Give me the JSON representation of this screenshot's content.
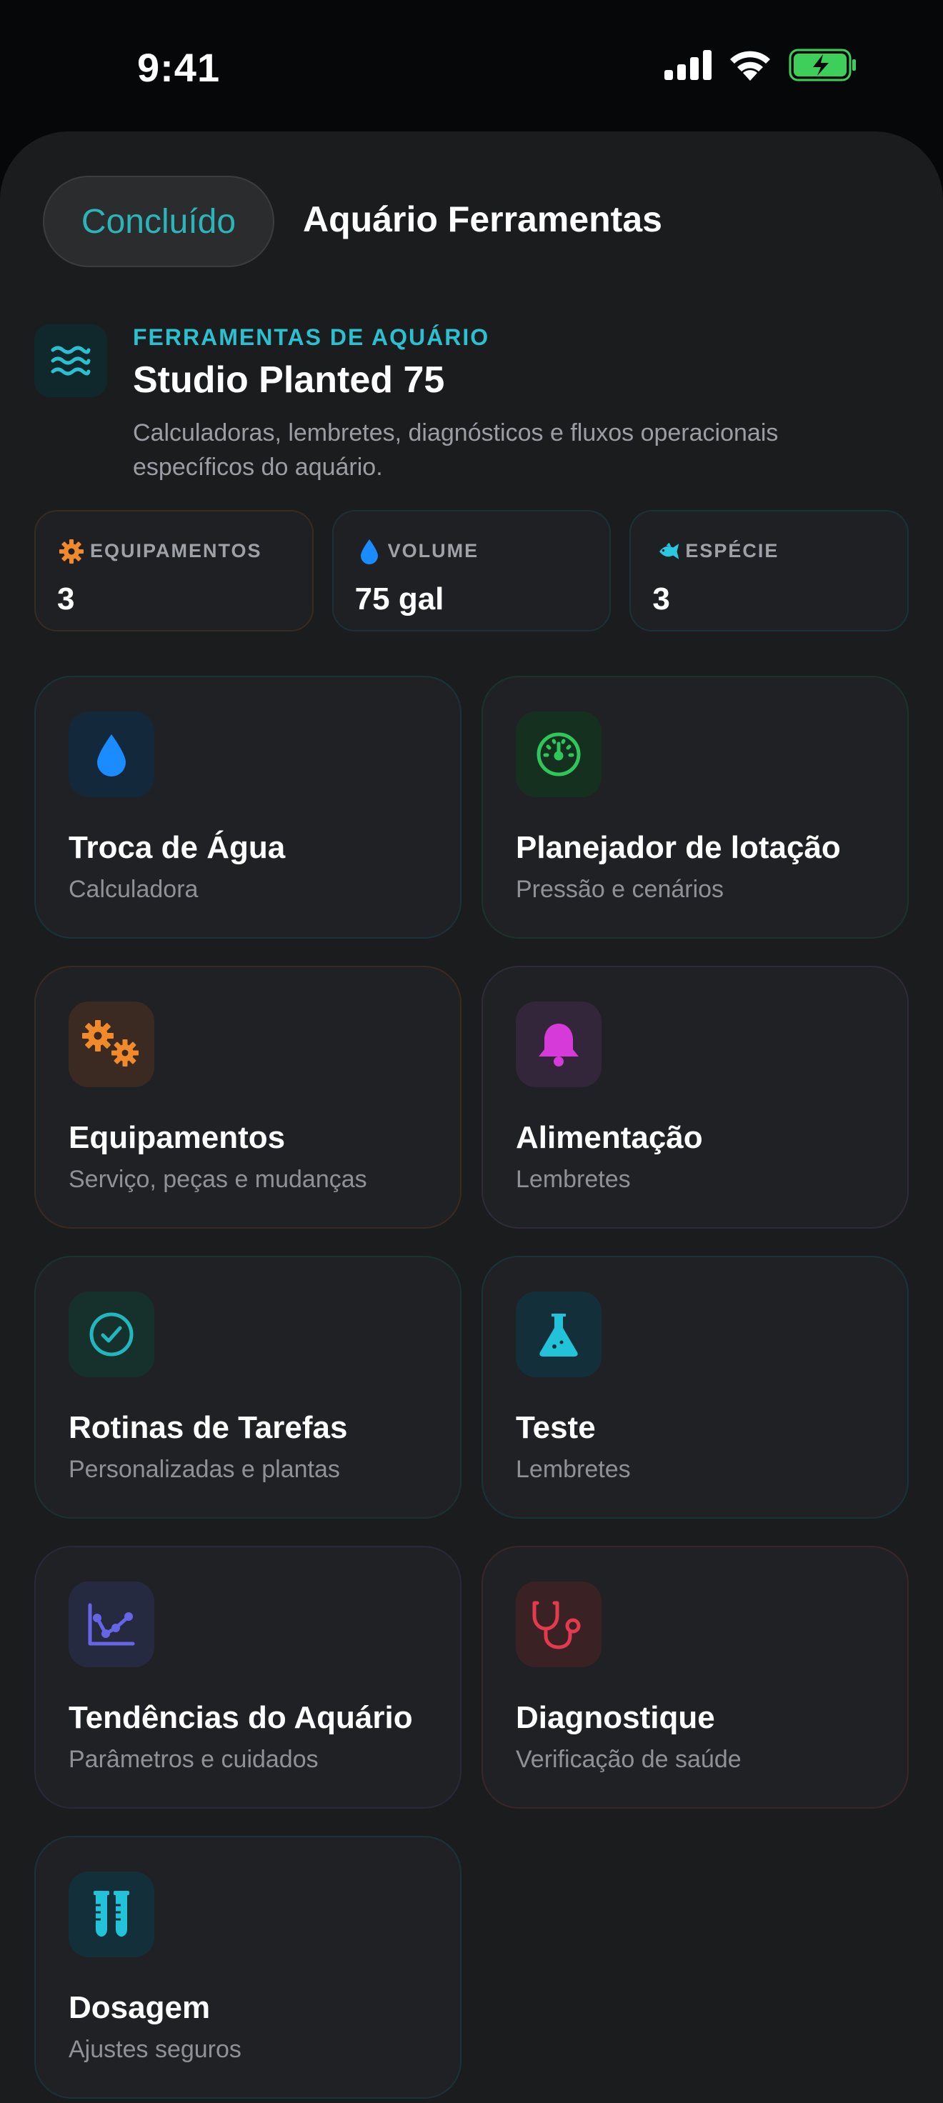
{
  "status_bar": {
    "time": "9:41"
  },
  "header": {
    "done_label": "Concluído",
    "title": "Aquário Ferramentas"
  },
  "hero": {
    "icon": "waves-icon",
    "kicker": "FERRAMENTAS DE AQUÁRIO",
    "title": "Studio Planted 75",
    "description": "Calculadoras, lembretes, diagnósticos e fluxos operacionais específicos do aquário."
  },
  "stats": [
    {
      "icon": "gear-icon",
      "label": "EQUIPAMENTOS",
      "value": "3",
      "color": "#f08a2a"
    },
    {
      "icon": "drop-icon",
      "label": "VOLUME",
      "value": "75 gal",
      "color": "#1a8cff"
    },
    {
      "icon": "fish-icon",
      "label": "ESPÉCIE",
      "value": "3",
      "color": "#2bc7e0"
    }
  ],
  "tools": [
    {
      "name": "water-change",
      "icon": "drop-icon",
      "title": "Troca de Água",
      "subtitle": "Calculadora",
      "accent": "#1a8cff"
    },
    {
      "name": "stocking-planner",
      "icon": "gauge-icon",
      "title": "Planejador de lotação",
      "subtitle": "Pressão e cenários",
      "accent": "#2fc75a"
    },
    {
      "name": "equipment",
      "icon": "gears-icon",
      "title": "Equipamentos",
      "subtitle": "Serviço, peças e mudanças",
      "accent": "#f08a2a"
    },
    {
      "name": "feeding",
      "icon": "bell-icon",
      "title": "Alimentação",
      "subtitle": "Lembretes",
      "accent": "#d63ad8"
    },
    {
      "name": "task-routines",
      "icon": "check-circle-icon",
      "title": "Rotinas de Tarefas",
      "subtitle": "Personalizadas e plantas",
      "accent": "#22b7bf"
    },
    {
      "name": "testing",
      "icon": "flask-icon",
      "title": "Teste",
      "subtitle": "Lembretes",
      "accent": "#22c3d8"
    },
    {
      "name": "aquarium-trends",
      "icon": "chart-icon",
      "title": "Tendências do Aquário",
      "subtitle": "Parâmetros e cuidados",
      "accent": "#6466e6"
    },
    {
      "name": "diagnose",
      "icon": "stethoscope-icon",
      "title": "Diagnostique",
      "subtitle": "Verificação de saúde",
      "accent": "#e33a4e"
    },
    {
      "name": "dosing",
      "icon": "test-tubes-icon",
      "title": "Dosagem",
      "subtitle": "Ajustes seguros",
      "accent": "#22c3d8"
    }
  ]
}
